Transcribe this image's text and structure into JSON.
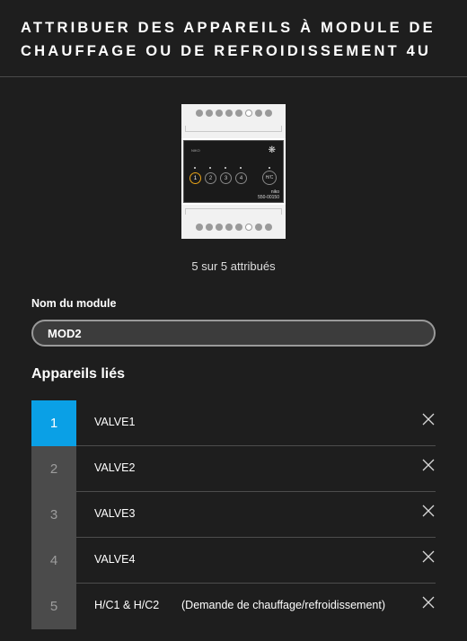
{
  "header": {
    "title": "ATTRIBUER DES APPAREILS À MODULE DE CHAUFFAGE OU DE REFROIDISSEMENT 4U"
  },
  "module_image": {
    "brand": "NIKO",
    "buttons": [
      "1",
      "2",
      "3",
      "4",
      "H/C"
    ],
    "model_line1": "niko",
    "model_line2": "550-00150"
  },
  "assigned_status": "5 sur 5 attribués",
  "module_name": {
    "label": "Nom du module",
    "value": "MOD2"
  },
  "linked_devices": {
    "heading": "Appareils liés",
    "items": [
      {
        "number": "1",
        "name": "VALVE1",
        "description": ""
      },
      {
        "number": "2",
        "name": "VALVE2",
        "description": ""
      },
      {
        "number": "3",
        "name": "VALVE3",
        "description": ""
      },
      {
        "number": "4",
        "name": "VALVE4",
        "description": ""
      },
      {
        "number": "5",
        "name": "H/C1 & H/C2",
        "description": "(Demande de chauffage/refroidissement)"
      }
    ]
  },
  "colors": {
    "background": "#1e1e1e",
    "accent": "#0aa0e6",
    "selected_button_ring": "#e8a317"
  },
  "icons": {
    "remove": "close-icon"
  }
}
